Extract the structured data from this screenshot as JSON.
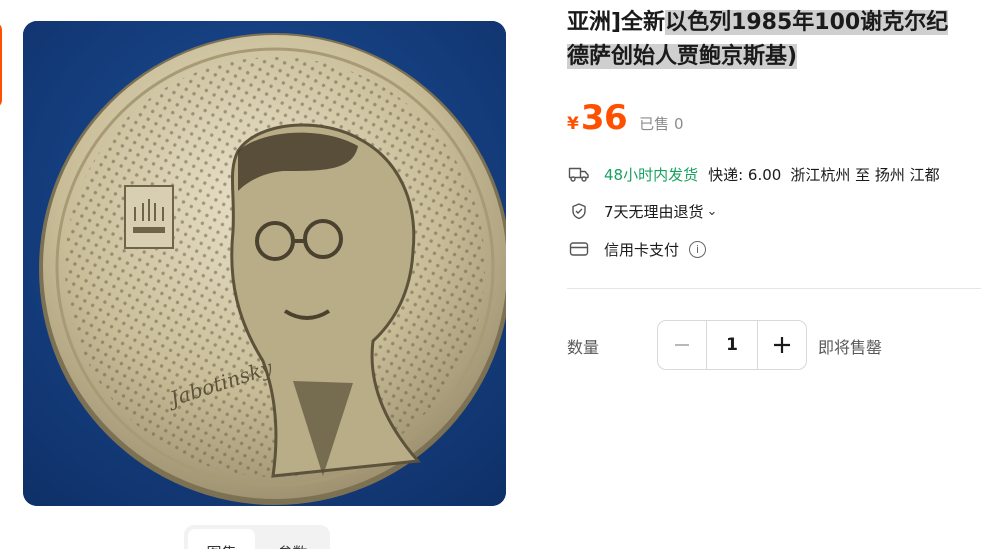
{
  "product": {
    "title_line1_plain": "亚洲]全新",
    "title_line1_highlight": "以色列1985年100谢克尔纪",
    "title_line2_highlight": "德萨创始人贾鲍京斯基)",
    "price_symbol": "¥",
    "price": "36",
    "sold_text": "已售 0"
  },
  "services": {
    "shipping_promise": "48小时内发货",
    "shipping_fee": "快递: 6.00",
    "route": "浙江杭州 至 扬州 江都",
    "return_policy": "7天无理由退货",
    "return_chevron": "⌄",
    "payment": "信用卡支付",
    "info_glyph": "i"
  },
  "purchase": {
    "quantity_label": "数量",
    "quantity_value": "1",
    "stock_note": "即将售罄"
  },
  "image_tabs": [
    {
      "label": "图集",
      "active": true
    },
    {
      "label": "参数",
      "active": false
    }
  ],
  "colors": {
    "accent": "#ff5000",
    "green": "#19a15f",
    "highlight": "#cfcfcf"
  },
  "icons": {
    "truck": "truck-icon",
    "return": "return-icon",
    "card": "credit-card-icon",
    "info": "info-icon",
    "minus": "minus-icon",
    "plus": "plus-icon"
  }
}
